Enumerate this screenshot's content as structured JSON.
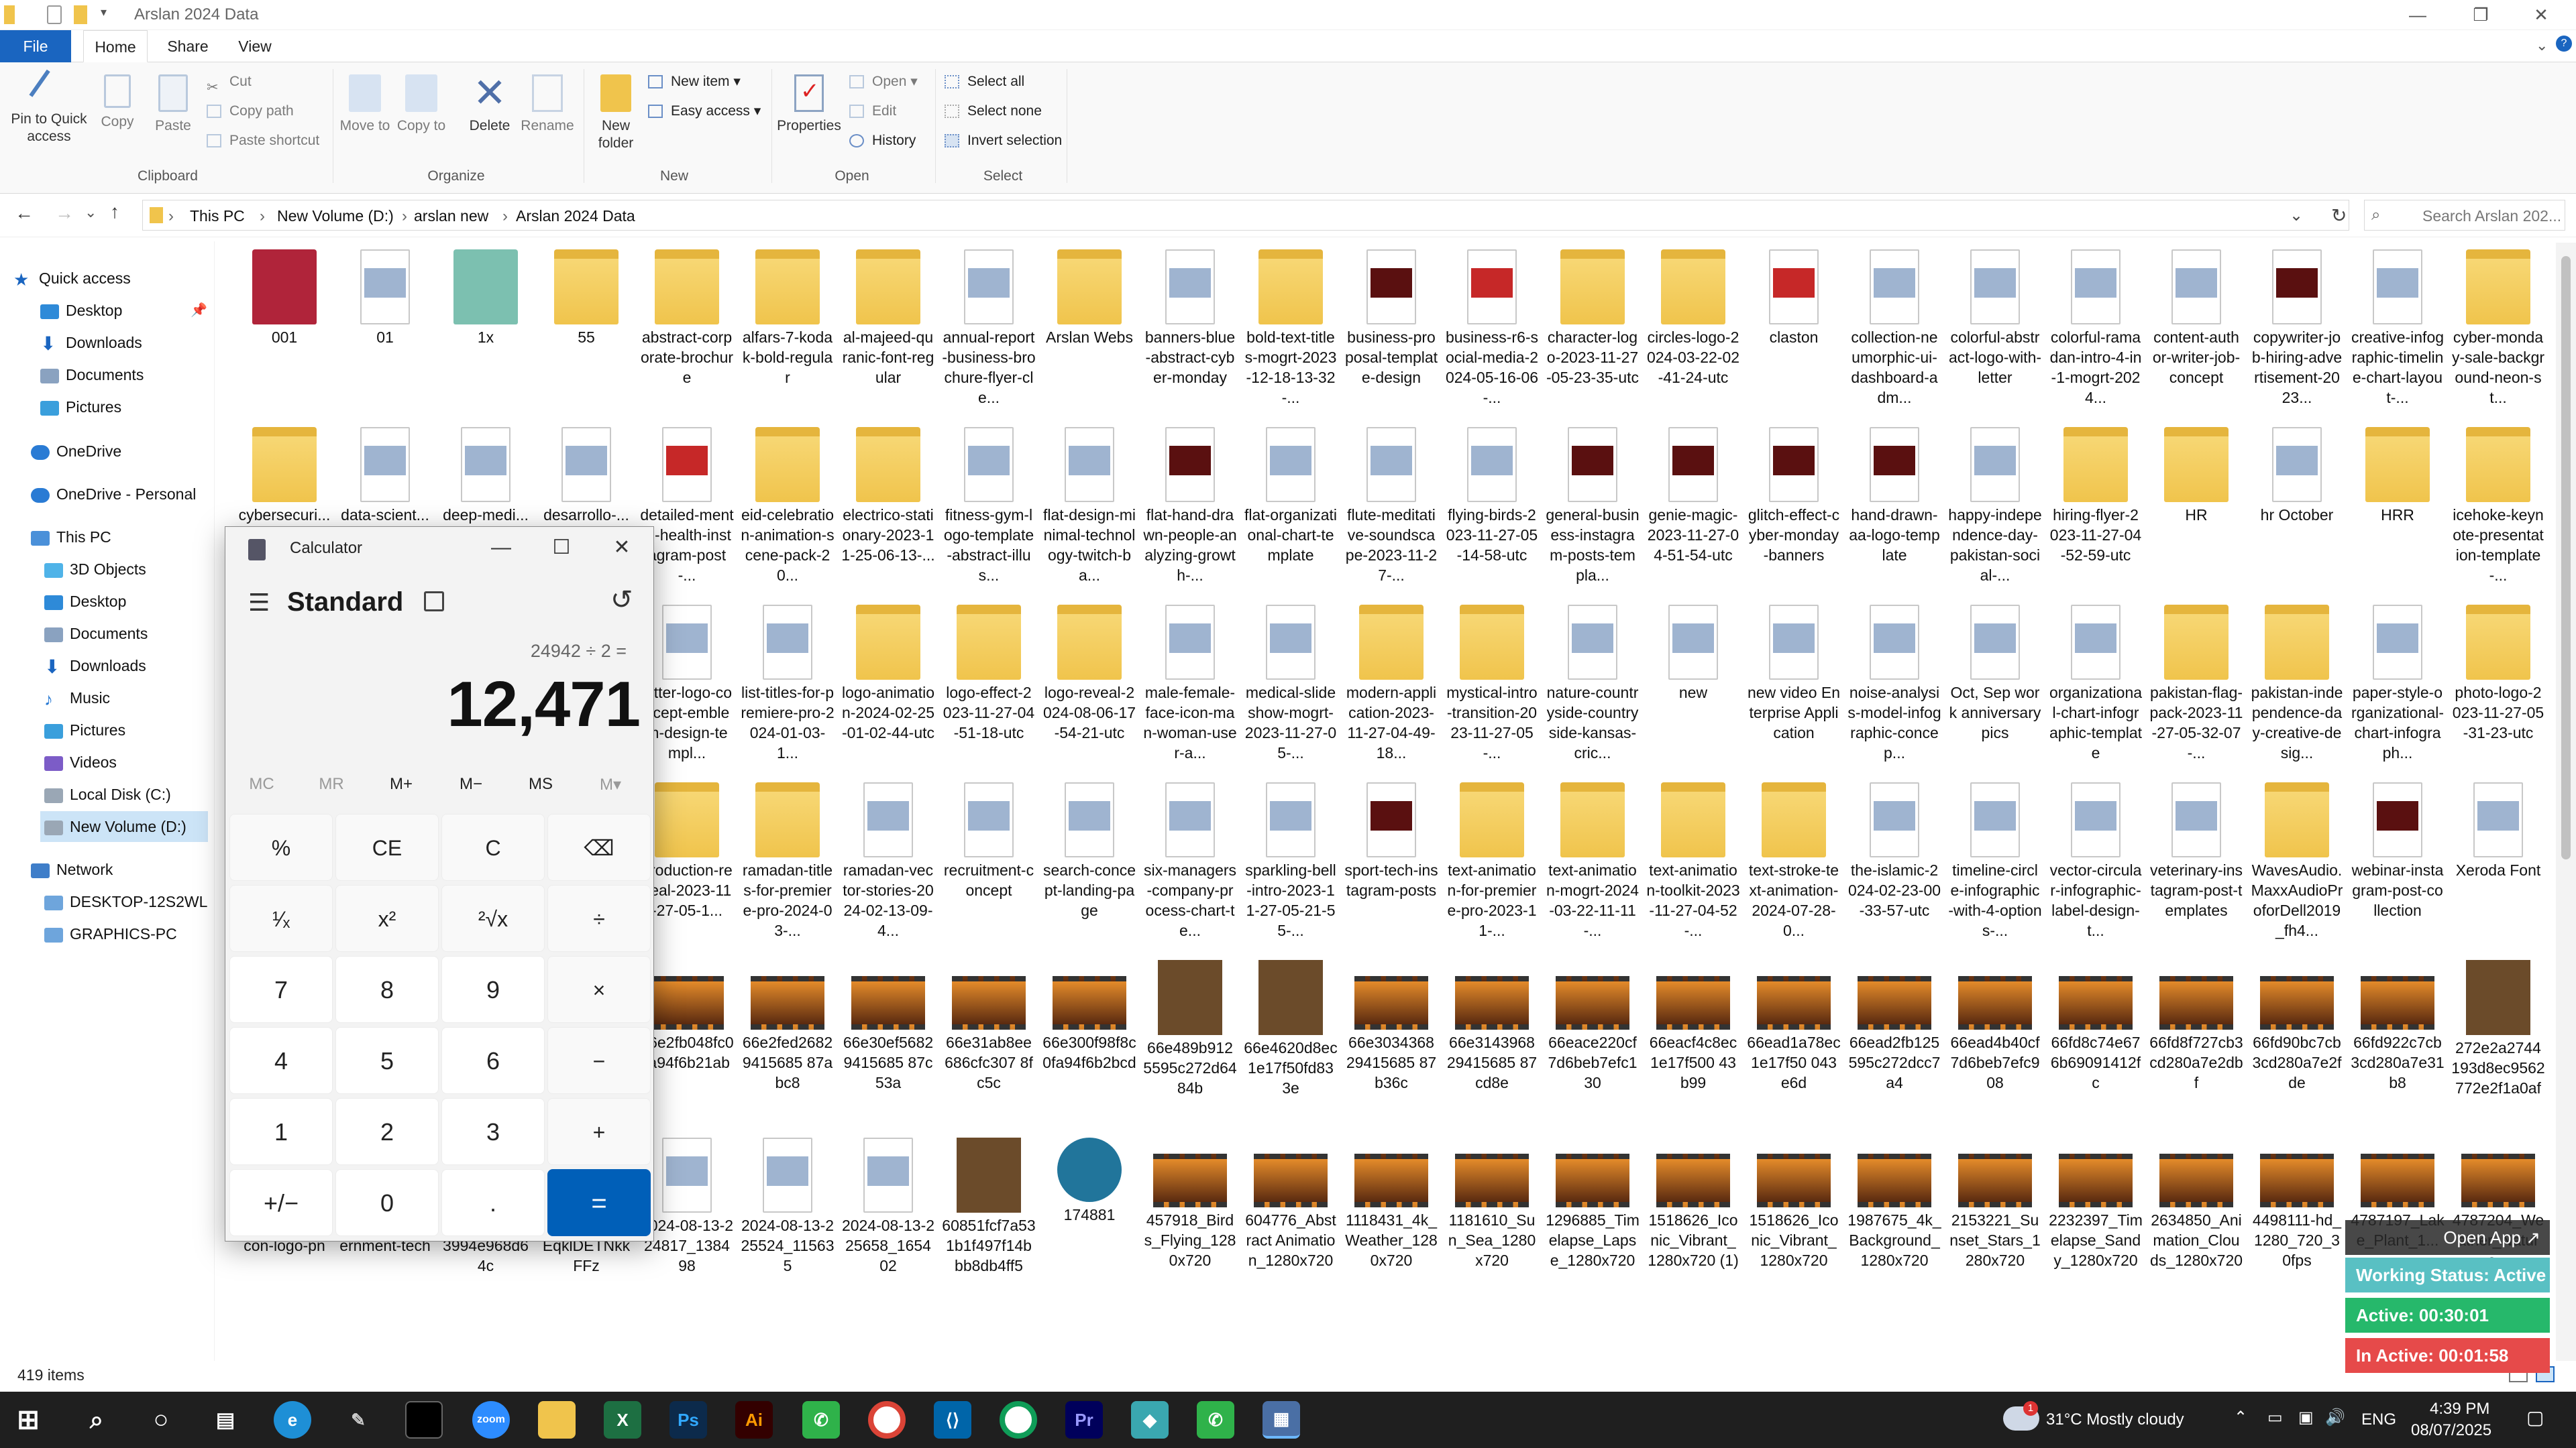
{
  "window": {
    "title": "Arslan 2024 Data"
  },
  "tabs": {
    "file": "File",
    "home": "Home",
    "share": "Share",
    "view": "View"
  },
  "ribbon": {
    "pin": "Pin to Quick access",
    "copy": "Copy",
    "paste": "Paste",
    "cut": "Cut",
    "copy_path": "Copy path",
    "paste_shortcut": "Paste shortcut",
    "clipboard": "Clipboard",
    "move_to": "Move to",
    "copy_to": "Copy to",
    "delete": "Delete",
    "rename": "Rename",
    "organize": "Organize",
    "new_folder": "New folder",
    "new_item": "New item",
    "easy_access": "Easy access",
    "new": "New",
    "properties": "Properties",
    "open": "Open",
    "edit": "Edit",
    "history": "History",
    "open_group": "Open",
    "select_all": "Select all",
    "select_none": "Select none",
    "invert": "Invert selection",
    "select": "Select"
  },
  "address": {
    "crumbs": [
      "This PC",
      "New Volume (D:)",
      "arslan new",
      "Arslan 2024 Data"
    ],
    "search_placeholder": "Search Arslan 202..."
  },
  "nav": {
    "quick_access": "Quick access",
    "desktop": "Desktop",
    "downloads": "Downloads",
    "documents": "Documents",
    "pictures": "Pictures",
    "onedrive": "OneDrive",
    "onedrive_personal": "OneDrive - Personal",
    "this_pc": "This PC",
    "objects3d": "3D Objects",
    "desktop2": "Desktop",
    "documents2": "Documents",
    "downloads2": "Downloads",
    "music": "Music",
    "pictures2": "Pictures",
    "videos": "Videos",
    "local_disk": "Local Disk (C:)",
    "new_volume": "New Volume (D:)",
    "network": "Network",
    "desktop_pc": "DESKTOP-12S2WL",
    "graphics_pc": "GRAPHICS-PC"
  },
  "files": {
    "row1": [
      "001",
      "01",
      "1x",
      "55",
      "abstract-corporate-brochure",
      "alfars-7-kodak-bold-regular",
      "al-majeed-quranic-font-regular",
      "annual-report-business-brochure-flyer-cle...",
      "Arslan Webs",
      "banners-blue-abstract-cyber-monday",
      "bold-text-titles-mogrt-2023-12-18-13-32-...",
      "business-proposal-template-design",
      "business-r6-social-media-2024-05-16-06-...",
      "character-logo-2023-11-27-05-23-35-utc",
      "circles-logo-2024-03-22-02-41-24-utc",
      "claston",
      "collection-neumorphic-ui-dashboard-adm...",
      "colorful-abstract-logo-with-letter",
      "colorful-ramadan-intro-4-in-1-mogrt-2024...",
      "content-author-writer-job-concept",
      "copywriter-job-hiring-advertisement-2023...",
      "creative-infographic-timeline-chart-layout-...",
      "cyber-monday-sale-background-neon-st..."
    ],
    "row2": [
      "cybersecuri...",
      "data-scient...",
      "deep-medi...",
      "desarrollo-...",
      "detailed-mental-health-instagram-post-...",
      "eid-celebration-animation-scene-pack-20...",
      "electrico-stationary-2023-11-25-06-13-...",
      "fitness-gym-logo-template-abstract-illus...",
      "flat-design-minimal-technology-twitch-ba...",
      "flat-hand-drawn-people-analyzing-growth-...",
      "flat-organizational-chart-template",
      "flute-meditative-soundscape-2023-11-27-...",
      "flying-birds-2023-11-27-05-14-58-utc",
      "general-business-instagram-posts-templa...",
      "genie-magic-2023-11-27-04-51-54-utc",
      "glitch-effect-cyber-monday-banners",
      "hand-drawn-aa-logo-template",
      "happy-independence-day-pakistan-social-...",
      "hiring-flyer-2023-11-27-04-52-59-utc",
      "HR",
      "hr October",
      "HRR",
      "icehoke-keynote-presentation-template-..."
    ],
    "row3": [
      "",
      "",
      "",
      "",
      "letter-logo-concept-emblem-design-templ...",
      "list-titles-for-premiere-pro-2024-01-03-1...",
      "logo-animation-2024-02-25-01-02-44-utc",
      "logo-effect-2023-11-27-04-51-18-utc",
      "logo-reveal-2024-08-06-17-54-21-utc",
      "male-female-face-icon-man-woman-user-a...",
      "medical-slideshow-mogrt-2023-11-27-05-...",
      "modern-application-2023-11-27-04-49-18...",
      "mystical-intro-transition-2023-11-27-05-...",
      "nature-countryside-countryside-kansas-cric...",
      "new",
      "new video Enterprise Application",
      "noise-analysis-model-infographic-concep...",
      "Oct, Sep work anniversary pics",
      "organizational-chart-infographic-template",
      "pakistan-flag-pack-2023-11-27-05-32-07-...",
      "pakistan-independence-day-creative-desig...",
      "paper-style-organizational-chart-infograph...",
      "photo-logo-2023-11-27-05-31-23-utc"
    ],
    "row4": [
      "",
      "",
      "",
      "",
      "production-reveal-2023-11-27-05-1...",
      "ramadan-titles-for-premiere-pro-2024-03-...",
      "ramadan-vector-stories-2024-02-13-09-4...",
      "recruitment-concept",
      "search-concept-landing-page",
      "six-managers-company-process-chart-te...",
      "sparkling-bell-intro-2023-11-27-05-21-55-...",
      "sport-tech-instagram-posts",
      "text-animation-for-premiere-pro-2023-11-...",
      "text-animation-mogrt-2024-03-22-11-11-...",
      "text-animation-toolkit-2023-11-27-04-52-...",
      "text-stroke-text-animation-2024-07-28-0...",
      "the-islamic-2024-02-23-00-33-57-utc",
      "timeline-circle-infographic-with-4-options-...",
      "vector-circular-infographic-label-design-t...",
      "veterinary-instagram-post-templates",
      "WavesAudio.MaxxAudioProforDell2019_fh4...",
      "webinar-instagram-post-collection",
      "Xeroda Font"
    ],
    "row5": [
      "",
      "",
      "",
      "",
      "66e2fb048fc0fa94f6b21ab",
      "66e2fed26829415685 87abc8",
      "66e30ef56829415685 87c53a",
      "66e31ab8ee686cfc307 8fc5c",
      "66e300f98f8c0fa94f6b2bcd",
      "66e489b9125595c272d6484b",
      "66e4620d8ec1e17f50fd833e",
      "66e303436829415685 87b36c",
      "66e314396829415685 87cd8e",
      "66eace220cf7d6beb7efc130",
      "66eacf4c8ec1e17f500 43b99",
      "66ead1a78ec1e17f50 043e6d",
      "66ead2fb125595c272dcc7a4",
      "66ead4b40cf7d6beb7efc908",
      "66fd8c74e676b69091412fc",
      "66fd8f727cb3cd280a7e2dbf",
      "66fd90bc7cb3cd280a7e2fde",
      "66fd922c7cb3cd280a7e31b8",
      "272e2a2744193d8ec9562772e2f1a0af"
    ],
    "row6": [
      "-54_angular-icon-logo-pn",
      "18_news-government-tech",
      "331db5d5c333994e968d64c",
      "2051951_x7EqklDETNkkFFz",
      "2024-08-13-224817_138498",
      "2024-08-13-225524_115635",
      "2024-08-13-225658_165402",
      "60851fcf7a531b1f497f14bbb8db4ff5",
      "174881",
      "457918_Birds_Flying_1280x720",
      "604776_Abstract Animation_1280x720",
      "1118431_4k_Weather_1280x720",
      "1181610_Sun_Sea_1280x720",
      "1296885_Timelapse_Lapse_1280x720",
      "1518626_Iconic_Vibrant_1280x720 (1)",
      "1518626_Iconic_Vibrant_1280x720",
      "1987675_4k_Background_1280x720",
      "2153221_Sunset_Stars_1280x720",
      "2232397_Timelapse_Sandy_1280x720",
      "2634850_Animation_Clouds_1280x720",
      "4498111-hd_1280_720_30fps",
      "4787197_Lake_Plant_1...",
      "4787204_Weather_Nature..."
    ]
  },
  "status": {
    "count": "419 items"
  },
  "calculator": {
    "title": "Calculator",
    "mode": "Standard",
    "expression": "24942 ÷ 2 =",
    "result": "12,471",
    "memory": [
      "MC",
      "MR",
      "M+",
      "M−",
      "MS",
      "M▾"
    ],
    "keys": [
      "%",
      "CE",
      "C",
      "⌫",
      "¹⁄ₓ",
      "x²",
      "²√x",
      "÷",
      "7",
      "8",
      "9",
      "×",
      "4",
      "5",
      "6",
      "−",
      "1",
      "2",
      "3",
      "+",
      "+/−",
      "0",
      ".",
      "="
    ]
  },
  "overlay": {
    "open_app": "Open App ↗",
    "working": "Working Status: Active",
    "active": "Active: 00:30:01",
    "inactive": "In Active: 00:01:58"
  },
  "taskbar": {
    "weather": "31°C  Mostly cloudy",
    "lang": "ENG",
    "time": "4:39 PM",
    "date": "08/07/2025",
    "badge": "1"
  }
}
